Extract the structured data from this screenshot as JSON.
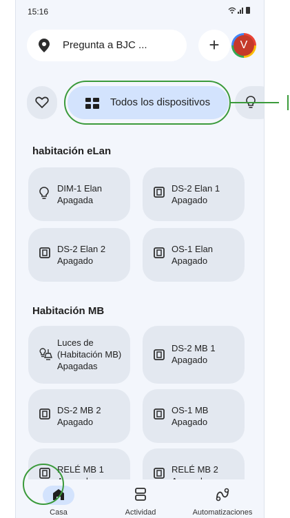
{
  "status_bar": {
    "time": "15:16",
    "icons": "wifi signal battery"
  },
  "top_bar": {
    "search_text": "Pregunta a BJC ...",
    "add_symbol": "+",
    "avatar_letter": "V"
  },
  "chips": {
    "favorites_icon": "heart-icon",
    "all_devices_label": "Todos los dispositivos",
    "lights_icon": "lightbulb-icon"
  },
  "rooms": [
    {
      "title": "habitación eLan",
      "devices": [
        {
          "name": "DIM-1 Elan",
          "state": "Apagada",
          "icon": "lightbulb-icon"
        },
        {
          "name": "DS-2 Elan 1",
          "state": "Apagado",
          "icon": "switch-icon"
        },
        {
          "name": "DS-2 Elan 2",
          "state": "Apagado",
          "icon": "switch-icon"
        },
        {
          "name": "OS-1 Elan",
          "state": "Apagado",
          "icon": "switch-icon"
        }
      ]
    },
    {
      "title": "Habitación MB",
      "devices": [
        {
          "name": "Luces de",
          "name2": "(Habitación MB)",
          "state": "Apagadas",
          "icon": "lights-group-icon"
        },
        {
          "name": "DS-2 MB 1",
          "state": "Apagado",
          "icon": "switch-icon"
        },
        {
          "name": "DS-2 MB 2",
          "state": "Apagado",
          "icon": "switch-icon"
        },
        {
          "name": "OS-1 MB",
          "state": "Apagado",
          "icon": "switch-icon"
        },
        {
          "name": "RELÉ MB 1",
          "state": "Apagado",
          "icon": "switch-icon"
        },
        {
          "name": "RELÉ MB 2",
          "state": "Apagado",
          "icon": "switch-icon"
        }
      ]
    }
  ],
  "nav": [
    {
      "label": "Casa",
      "icon": "home-icon",
      "active": true
    },
    {
      "label": "Actividad",
      "icon": "activity-icon",
      "active": false
    },
    {
      "label": "Automatizaciones",
      "icon": "automations-icon",
      "active": false
    }
  ],
  "colors": {
    "accent": "#d3e3fd",
    "tile": "#e3e8f0",
    "background": "#f3f6fc",
    "highlight": "#3a9a3a"
  }
}
